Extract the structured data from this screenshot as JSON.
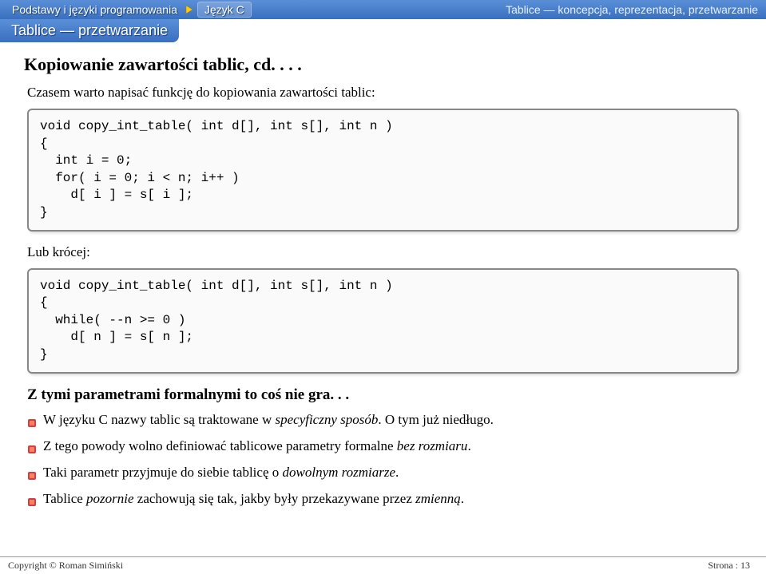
{
  "header": {
    "crumb1": "Podstawy i języki programowania",
    "crumb2": "Język C",
    "right": "Tablice — koncepcja, reprezentacja, przetwarzanie"
  },
  "subheader": "Tablice — przetwarzanie",
  "title": "Kopiowanie zawartości tablic, cd. . . .",
  "intro": "Czasem warto napisać funkcję do kopiowania zawartości tablic:",
  "code1": "void copy_int_table( int d[], int s[], int n )\n{\n  int i = 0;\n  for( i = 0; i < n; i++ )\n    d[ i ] = s[ i ];\n}",
  "label2": "Lub krócej:",
  "code2": "void copy_int_table( int d[], int s[], int n )\n{\n  while( --n >= 0 )\n    d[ n ] = s[ n ];\n}",
  "subtitle": "Z tymi parametrami formalnymi to coś nie gra. . .",
  "bullets": {
    "b1_pre": "W języku C nazwy tablic są traktowane w ",
    "b1_em": "specyficzny sposób",
    "b1_post": ". O tym już niedługo.",
    "b2_pre": "Z tego powody wolno definiować tablicowe parametry formalne ",
    "b2_em": "bez rozmiaru",
    "b2_post": ".",
    "b3_pre": "Taki parametr przyjmuje do siebie tablicę o ",
    "b3_em": "dowolnym rozmiarze",
    "b3_post": ".",
    "b4_pre": "Tablice ",
    "b4_em1": "pozornie",
    "b4_mid": " zachowują się tak, jakby były przekazywane przez ",
    "b4_em2": "zmienną",
    "b4_post": "."
  },
  "footer": {
    "left": "Copyright © Roman Simiński",
    "right": "Strona : 13"
  }
}
